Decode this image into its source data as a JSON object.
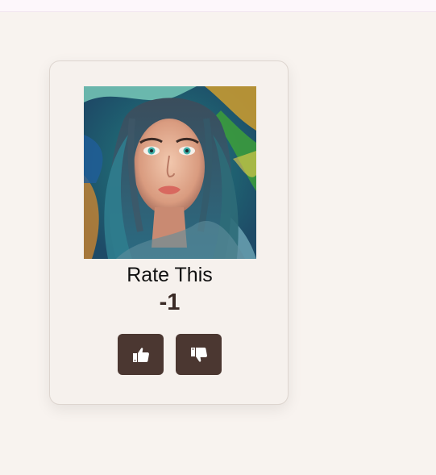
{
  "card": {
    "title": "Rate This",
    "score": "-1"
  },
  "buttons": {
    "upvote_icon": "thumbs-up-icon",
    "downvote_icon": "thumbs-down-icon"
  },
  "colors": {
    "page_background": "#f8f3ef",
    "card_background": "#f6f1ed",
    "button_background": "#4b3731",
    "icon_color": "#ffffff"
  }
}
